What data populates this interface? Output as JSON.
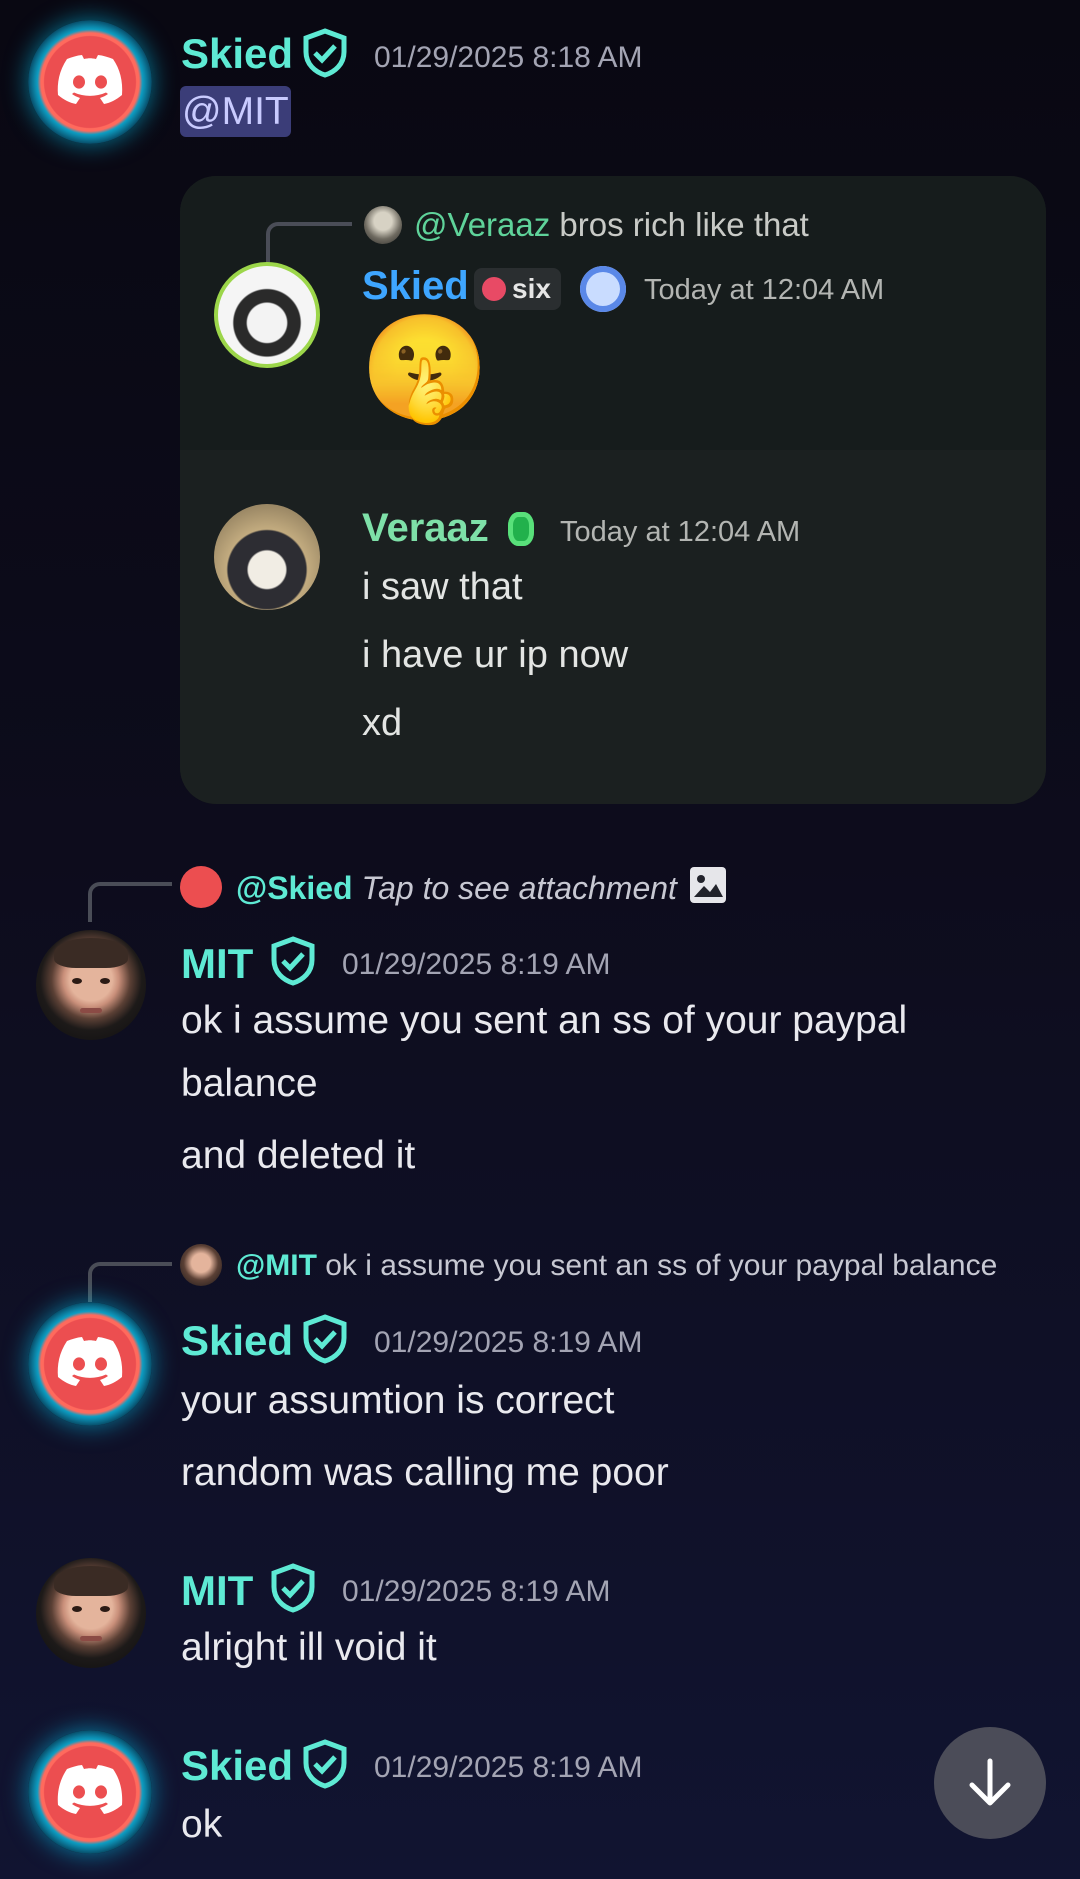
{
  "messages": [
    {
      "author": "Skied",
      "timestamp": "01/29/2025 8:18 AM",
      "text": "@MIT"
    },
    {
      "author": "MIT",
      "timestamp": "01/29/2025 8:19 AM",
      "reply": {
        "mention": "@Skied",
        "text": "Tap to see attachment"
      },
      "lines": [
        "ok i assume you sent an ss of your paypal",
        "balance",
        "and deleted it"
      ]
    },
    {
      "author": "Skied",
      "timestamp": "01/29/2025 8:19 AM",
      "reply": {
        "mention": "@MIT",
        "text": "ok i assume you sent an ss of your paypal balance"
      },
      "lines": [
        "your assumtion is correct",
        "random was calling me poor"
      ]
    },
    {
      "author": "MIT",
      "timestamp": "01/29/2025 8:19 AM",
      "lines": [
        "alright ill void it"
      ]
    },
    {
      "author": "Skied",
      "timestamp": "01/29/2025 8:19 AM",
      "lines": [
        "ok"
      ]
    }
  ],
  "embed": {
    "reply": {
      "mention": "@Veraaz",
      "text": "bros rich like that"
    },
    "first": {
      "author": "Skied",
      "tag": "six",
      "timestamp": "Today at 12:04 AM",
      "emoji": "🤫"
    },
    "second": {
      "author": "Veraaz",
      "timestamp": "Today at 12:04 AM",
      "lines": [
        "i saw that",
        "i have ur ip now",
        "xd"
      ]
    }
  },
  "colors": {
    "name_accent": "#5eead4",
    "embed_skied": "#3ea6ff",
    "embed_veraaz": "#7ee0a8",
    "mention_bg": "#3b3d78"
  },
  "icons": {
    "verified": "shield-check-icon",
    "scroll": "arrow-down-icon",
    "attachment": "image-icon"
  }
}
